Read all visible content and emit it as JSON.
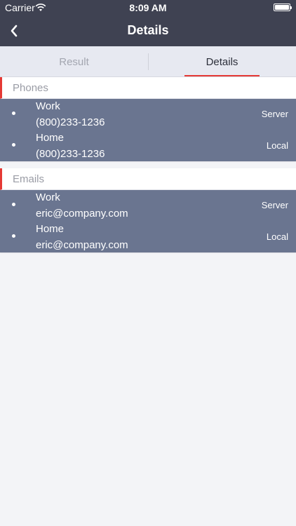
{
  "status_bar": {
    "carrier": "Carrier",
    "time": "8:09 AM",
    "wifi_icon": "wifi-icon",
    "battery_icon": "battery-icon",
    "battery_level": 1.0
  },
  "nav": {
    "title": "Details",
    "back_icon": "chevron-left-icon"
  },
  "tabs": [
    {
      "label": "Result",
      "active": false
    },
    {
      "label": "Details",
      "active": true
    }
  ],
  "colors": {
    "bar_background": "#3f4252",
    "accent": "#e53935",
    "list_background": "#6a7590",
    "tab_background": "#e7e9f1",
    "page_background": "#f3f4f7"
  },
  "sections": {
    "phones": {
      "title": "Phones",
      "items": [
        {
          "type": "Work",
          "value": "(800)233-1236",
          "source": "Server"
        },
        {
          "type": "Home",
          "value": "(800)233-1236",
          "source": "Local"
        }
      ]
    },
    "emails": {
      "title": "Emails",
      "items": [
        {
          "type": "Work",
          "value": "eric@company.com",
          "source": "Server"
        },
        {
          "type": "Home",
          "value": "eric@company.com",
          "source": "Local"
        }
      ]
    }
  }
}
